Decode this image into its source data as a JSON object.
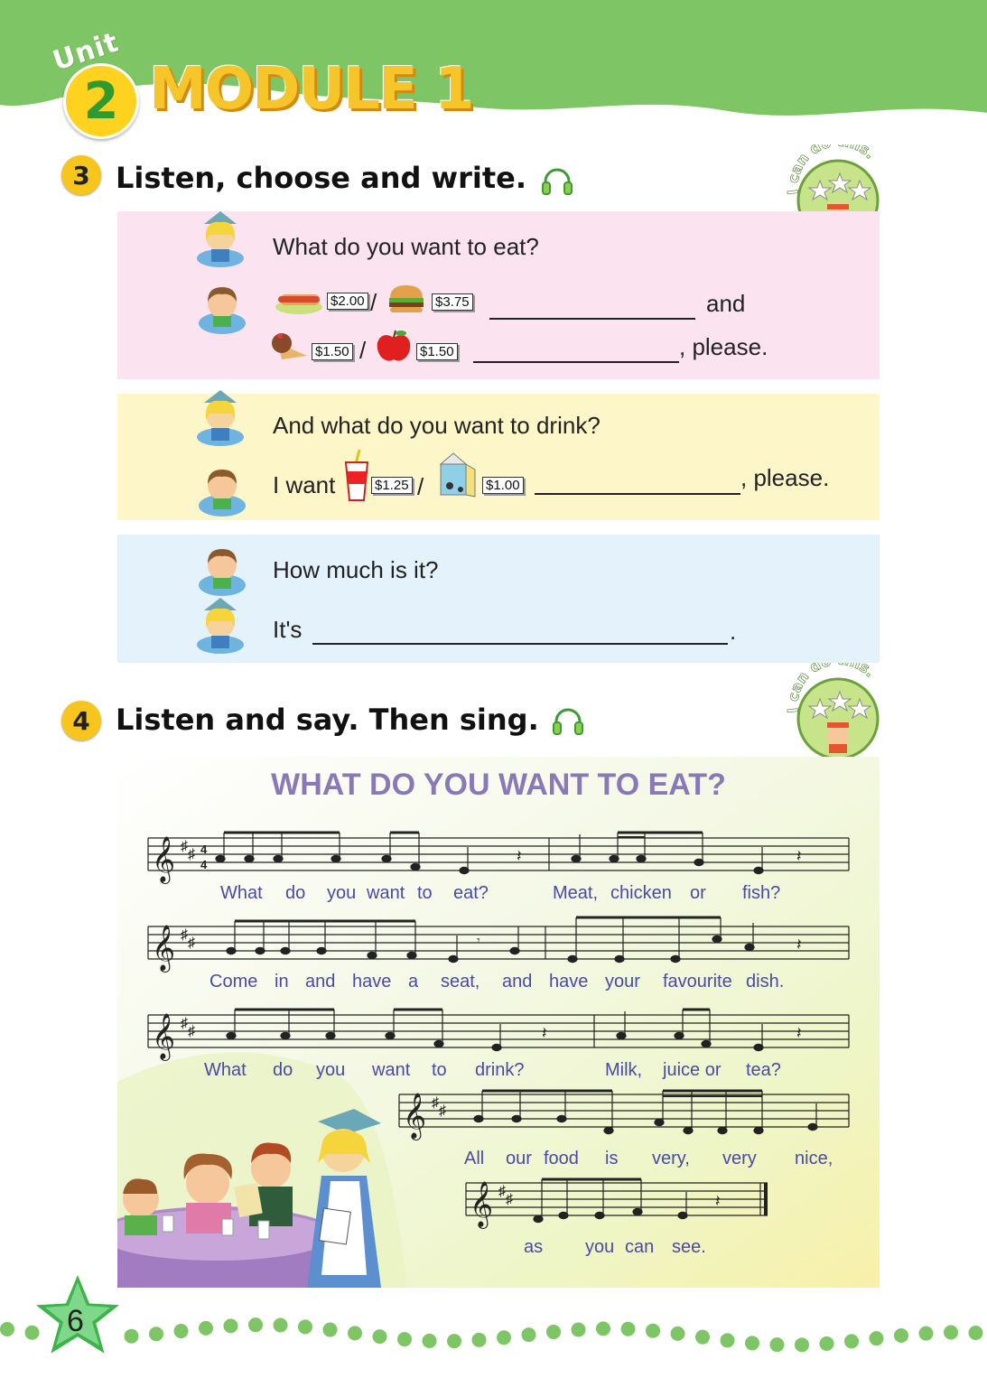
{
  "header": {
    "unit_label": "Unit",
    "unit_number": "2",
    "module_title": "MODULE 1",
    "colors": {
      "band": "#7ec566",
      "badge": "#ffd21f"
    }
  },
  "section3": {
    "number": "3",
    "title": "Listen, choose and write.",
    "badge_text": "I can do this.",
    "panel_pink": {
      "question": "What do you want to eat?",
      "prices_row1": [
        "$2.00",
        "$3.75"
      ],
      "food_row1": [
        "hot-dog-icon",
        "hamburger-icon"
      ],
      "and_text": "and",
      "prices_row2": [
        "$1.50",
        "$1.50"
      ],
      "food_row2": [
        "ice-cream-icon",
        "apple-icon"
      ],
      "please_text": ", please.",
      "separator": "/"
    },
    "panel_yellow": {
      "question": "And what do you want to drink?",
      "i_want": "I want",
      "prices": [
        "$1.25",
        "$1.00"
      ],
      "drinks": [
        "cola-cup-icon",
        "milk-carton-icon"
      ],
      "please_text": ", please.",
      "separator": "/"
    },
    "panel_blue": {
      "question": "How much is it?",
      "its": "It's",
      "period": "."
    }
  },
  "section4": {
    "number": "4",
    "title": "Listen and say. Then sing.",
    "badge_text": "I can do this.",
    "song_title": "WHAT DO YOU WANT TO EAT?",
    "lyrics": {
      "line1": [
        "What",
        "do",
        "you",
        "want",
        "to",
        "eat?",
        "Meat,",
        "chicken",
        "or",
        "fish?"
      ],
      "line2": [
        "Come",
        "in",
        "and",
        "have",
        "a",
        "seat,",
        "and",
        "have",
        "your",
        "favourite",
        "dish."
      ],
      "line3": [
        "What",
        "do",
        "you",
        "want",
        "to",
        "drink?",
        "Milk,",
        "juice or",
        "tea?"
      ],
      "line4": [
        "All",
        "our",
        "food",
        "is",
        "very,",
        "very",
        "nice,"
      ],
      "line5": [
        "as",
        "you",
        "can",
        "see."
      ]
    }
  },
  "footer": {
    "page_number": "6"
  }
}
